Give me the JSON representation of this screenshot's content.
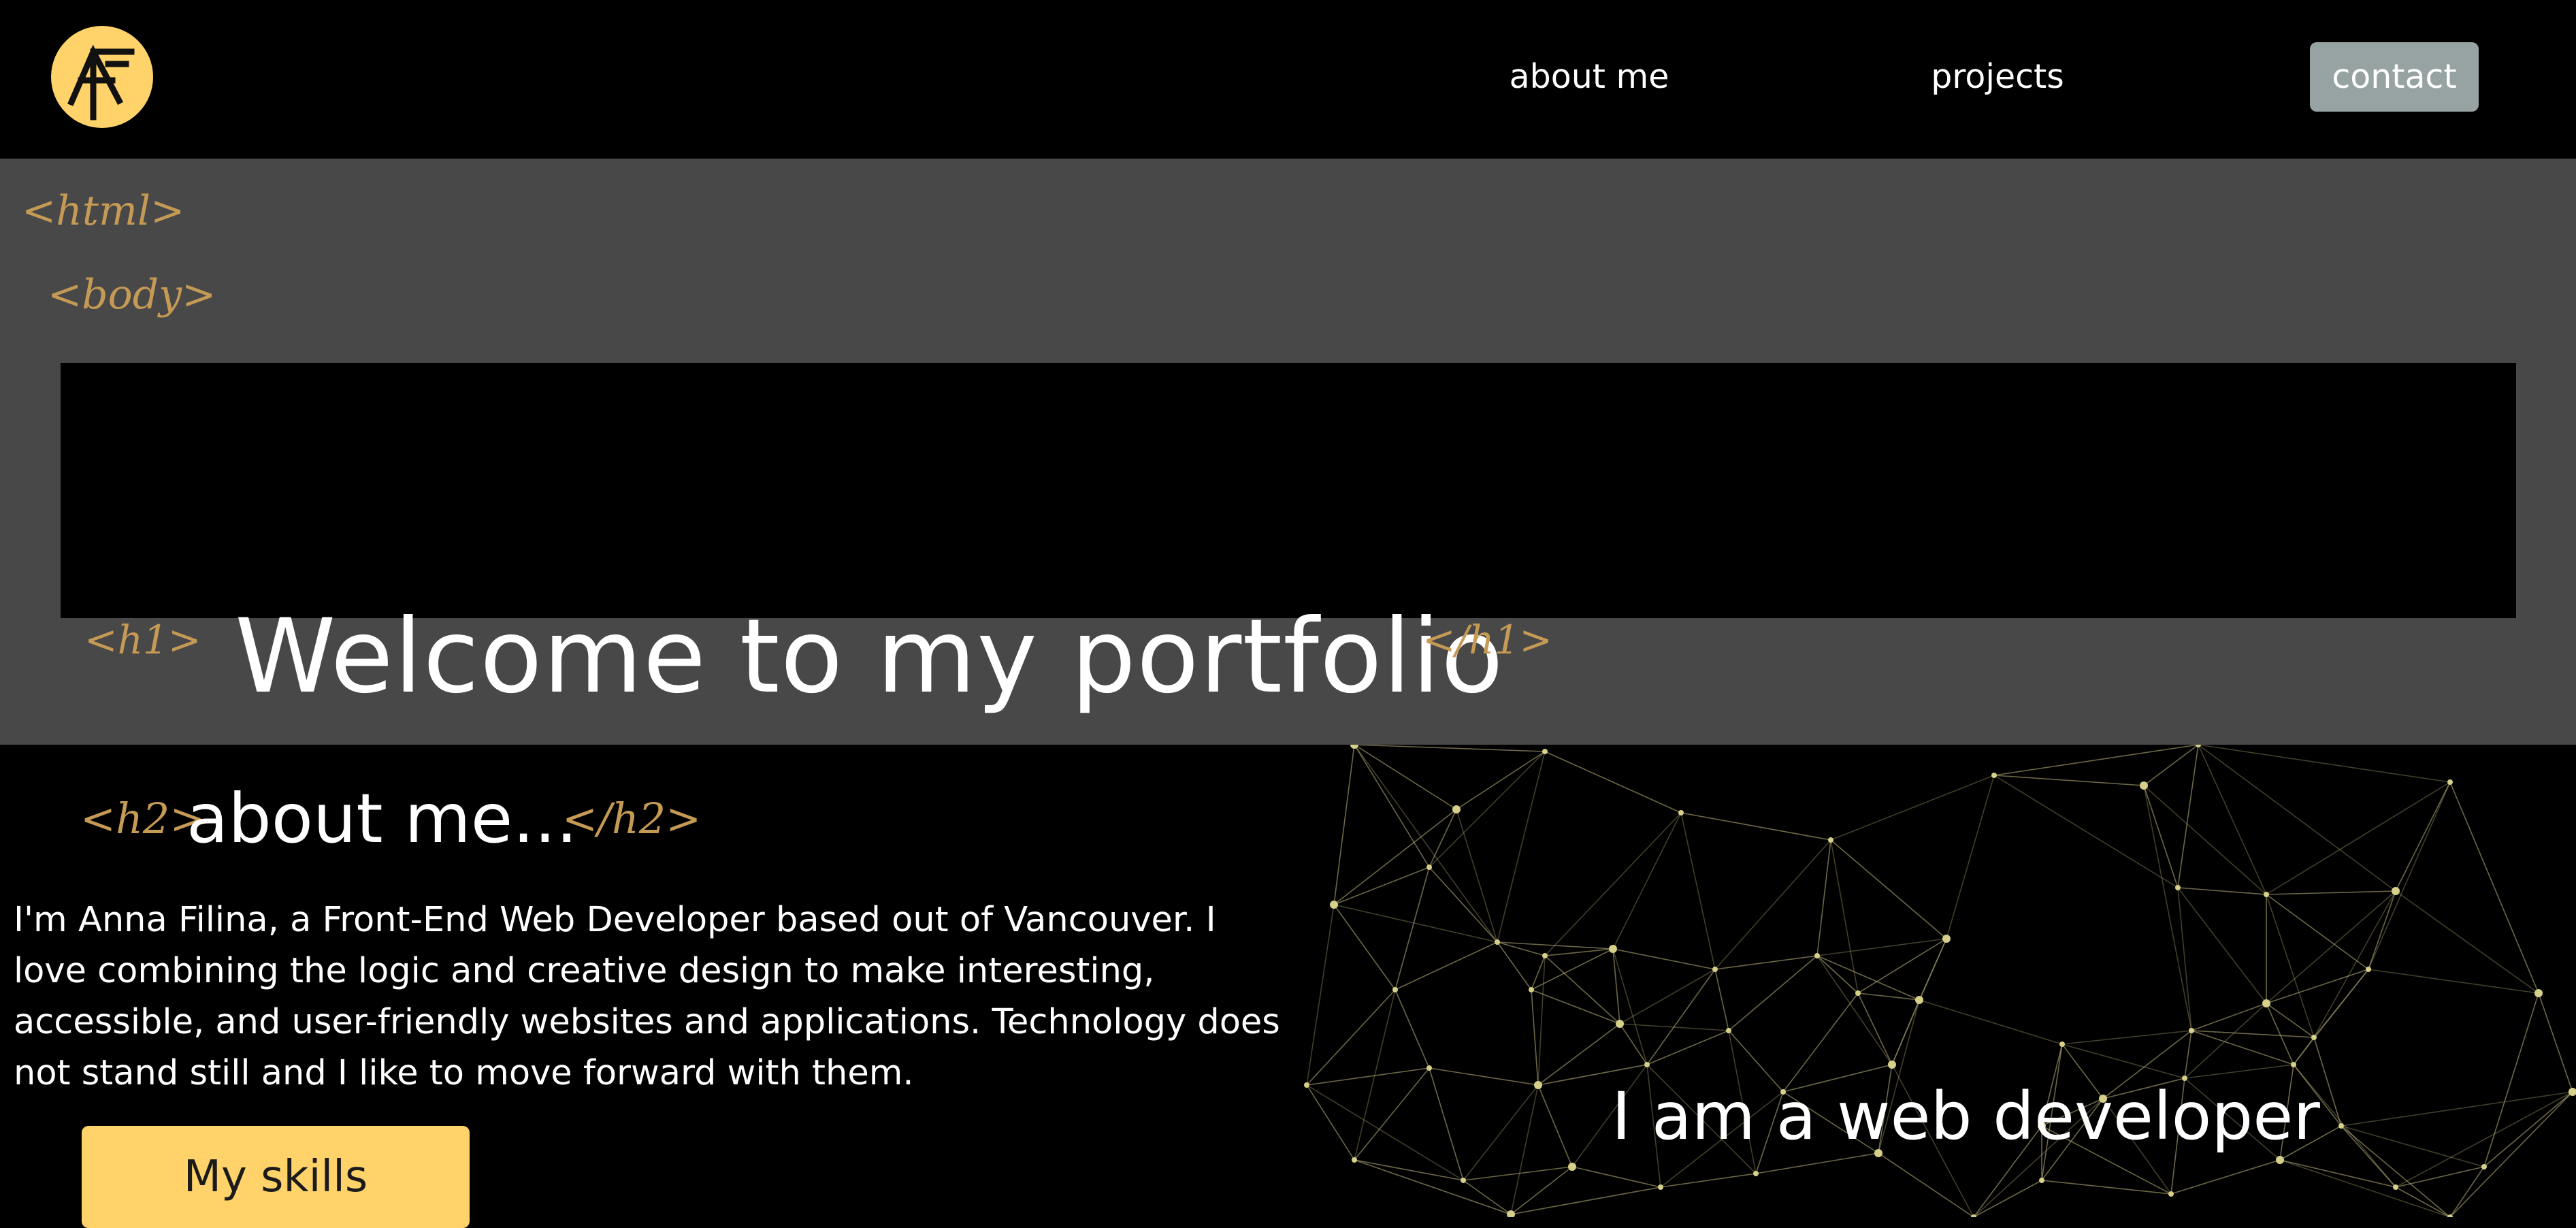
{
  "colors": {
    "accent": "#ffd36a",
    "tag": "#c59a55",
    "hero_bg": "#484848",
    "contact_bg": "#97a3a2"
  },
  "logo": {
    "icon": "af-monogram-logo-icon",
    "text": "AF"
  },
  "nav": {
    "items": [
      "about me",
      "projects",
      "contact"
    ]
  },
  "hero": {
    "tag_html": "<html>",
    "tag_body": "<body>",
    "tag_h1_open": "<h1>",
    "title": "Welcome to my portfolio",
    "tag_h1_close": "</h1>"
  },
  "about": {
    "tag_h2_open": "<h2>",
    "title": "about me...",
    "tag_h2_close": "</h2>",
    "text": "I'm Anna Filina, a Front-End Web Developer based out of Vancouver. I love combining the logic and creative design to make interesting, accessible, and user-friendly websites and applications. Technology does not stand still and I like to move forward with them.",
    "skills_button": "My skills",
    "tagline": "I am a web developer",
    "background": "network-graph-illustration"
  }
}
